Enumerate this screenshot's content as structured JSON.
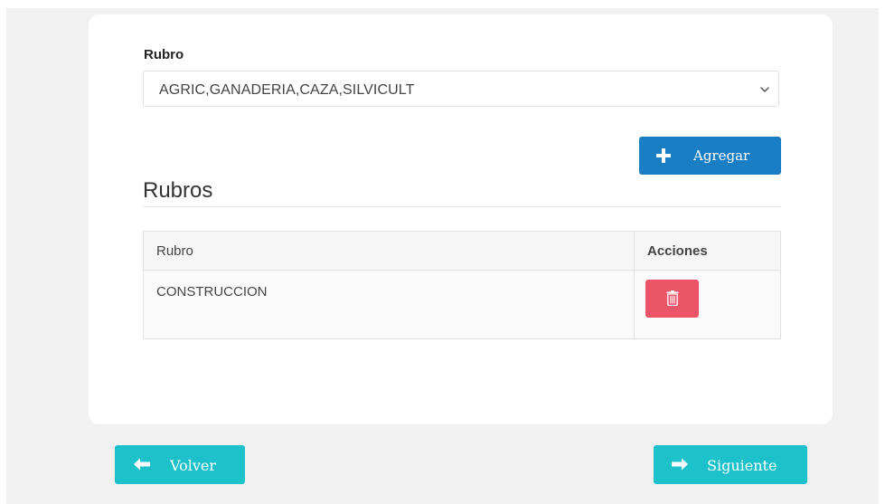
{
  "form": {
    "field_label": "Rubro",
    "select_value": "AGRIC,GANADERIA,CAZA,SILVICULT",
    "add_button_label": "Agregar"
  },
  "section": {
    "title": "Rubros"
  },
  "table": {
    "columns": [
      "Rubro",
      "Acciones"
    ],
    "rows": [
      {
        "rubro": "CONSTRUCCION",
        "action_icon": "trash-icon"
      }
    ]
  },
  "navigation": {
    "back_label": "Volver",
    "next_label": "Siguiente"
  },
  "colors": {
    "primary": "#1a7ec4",
    "danger": "#ec5468",
    "nav": "#1cc1c9",
    "background": "#f1f1f1"
  },
  "icons": {
    "add": "plus-icon",
    "select": "chevron-down-icon",
    "delete": "trash-icon",
    "back": "arrow-left-icon",
    "next": "arrow-right-icon"
  }
}
